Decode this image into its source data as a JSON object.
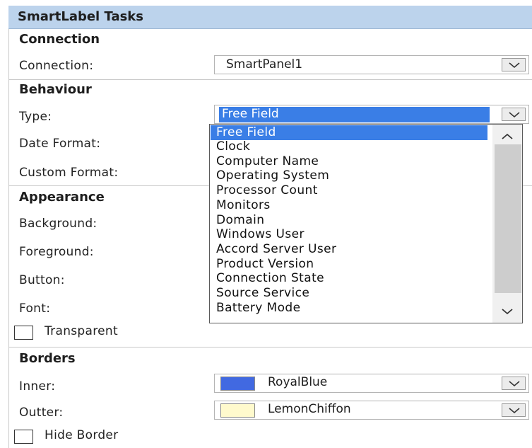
{
  "title": "SmartLabel Tasks",
  "connection": {
    "header": "Connection",
    "label": "Connection:",
    "value": "SmartPanel1"
  },
  "behaviour": {
    "header": "Behaviour",
    "type_label": "Type:",
    "type_value": "Free Field",
    "date_format_label": "Date Format:",
    "custom_format_label": "Custom Format:"
  },
  "dropdown": {
    "items": [
      "Free Field",
      "Clock",
      "Computer Name",
      "Operating System",
      "Processor Count",
      "Monitors",
      "Domain",
      "Windows User",
      "Accord Server User",
      "Product Version",
      "Connection State",
      "Source Service",
      "Battery Mode"
    ],
    "selected": "Free Field"
  },
  "appearance": {
    "header": "Appearance",
    "background_label": "Background:",
    "foreground_label": "Foreground:",
    "button_label": "Button:",
    "font_label": "Font:",
    "transparent_label": "Transparent",
    "transparent_checked": false
  },
  "borders": {
    "header": "Borders",
    "inner_label": "Inner:",
    "inner_value": "RoyalBlue",
    "inner_color": "#4169e1",
    "outter_label": "Outter:",
    "outter_value": "LemonChiffon",
    "outter_color": "#fffacd",
    "hide_border_label": "Hide Border",
    "hide_border_checked": false
  },
  "colors": {
    "title_bar": "#bcd3ec",
    "selection": "#3a7ee6"
  }
}
